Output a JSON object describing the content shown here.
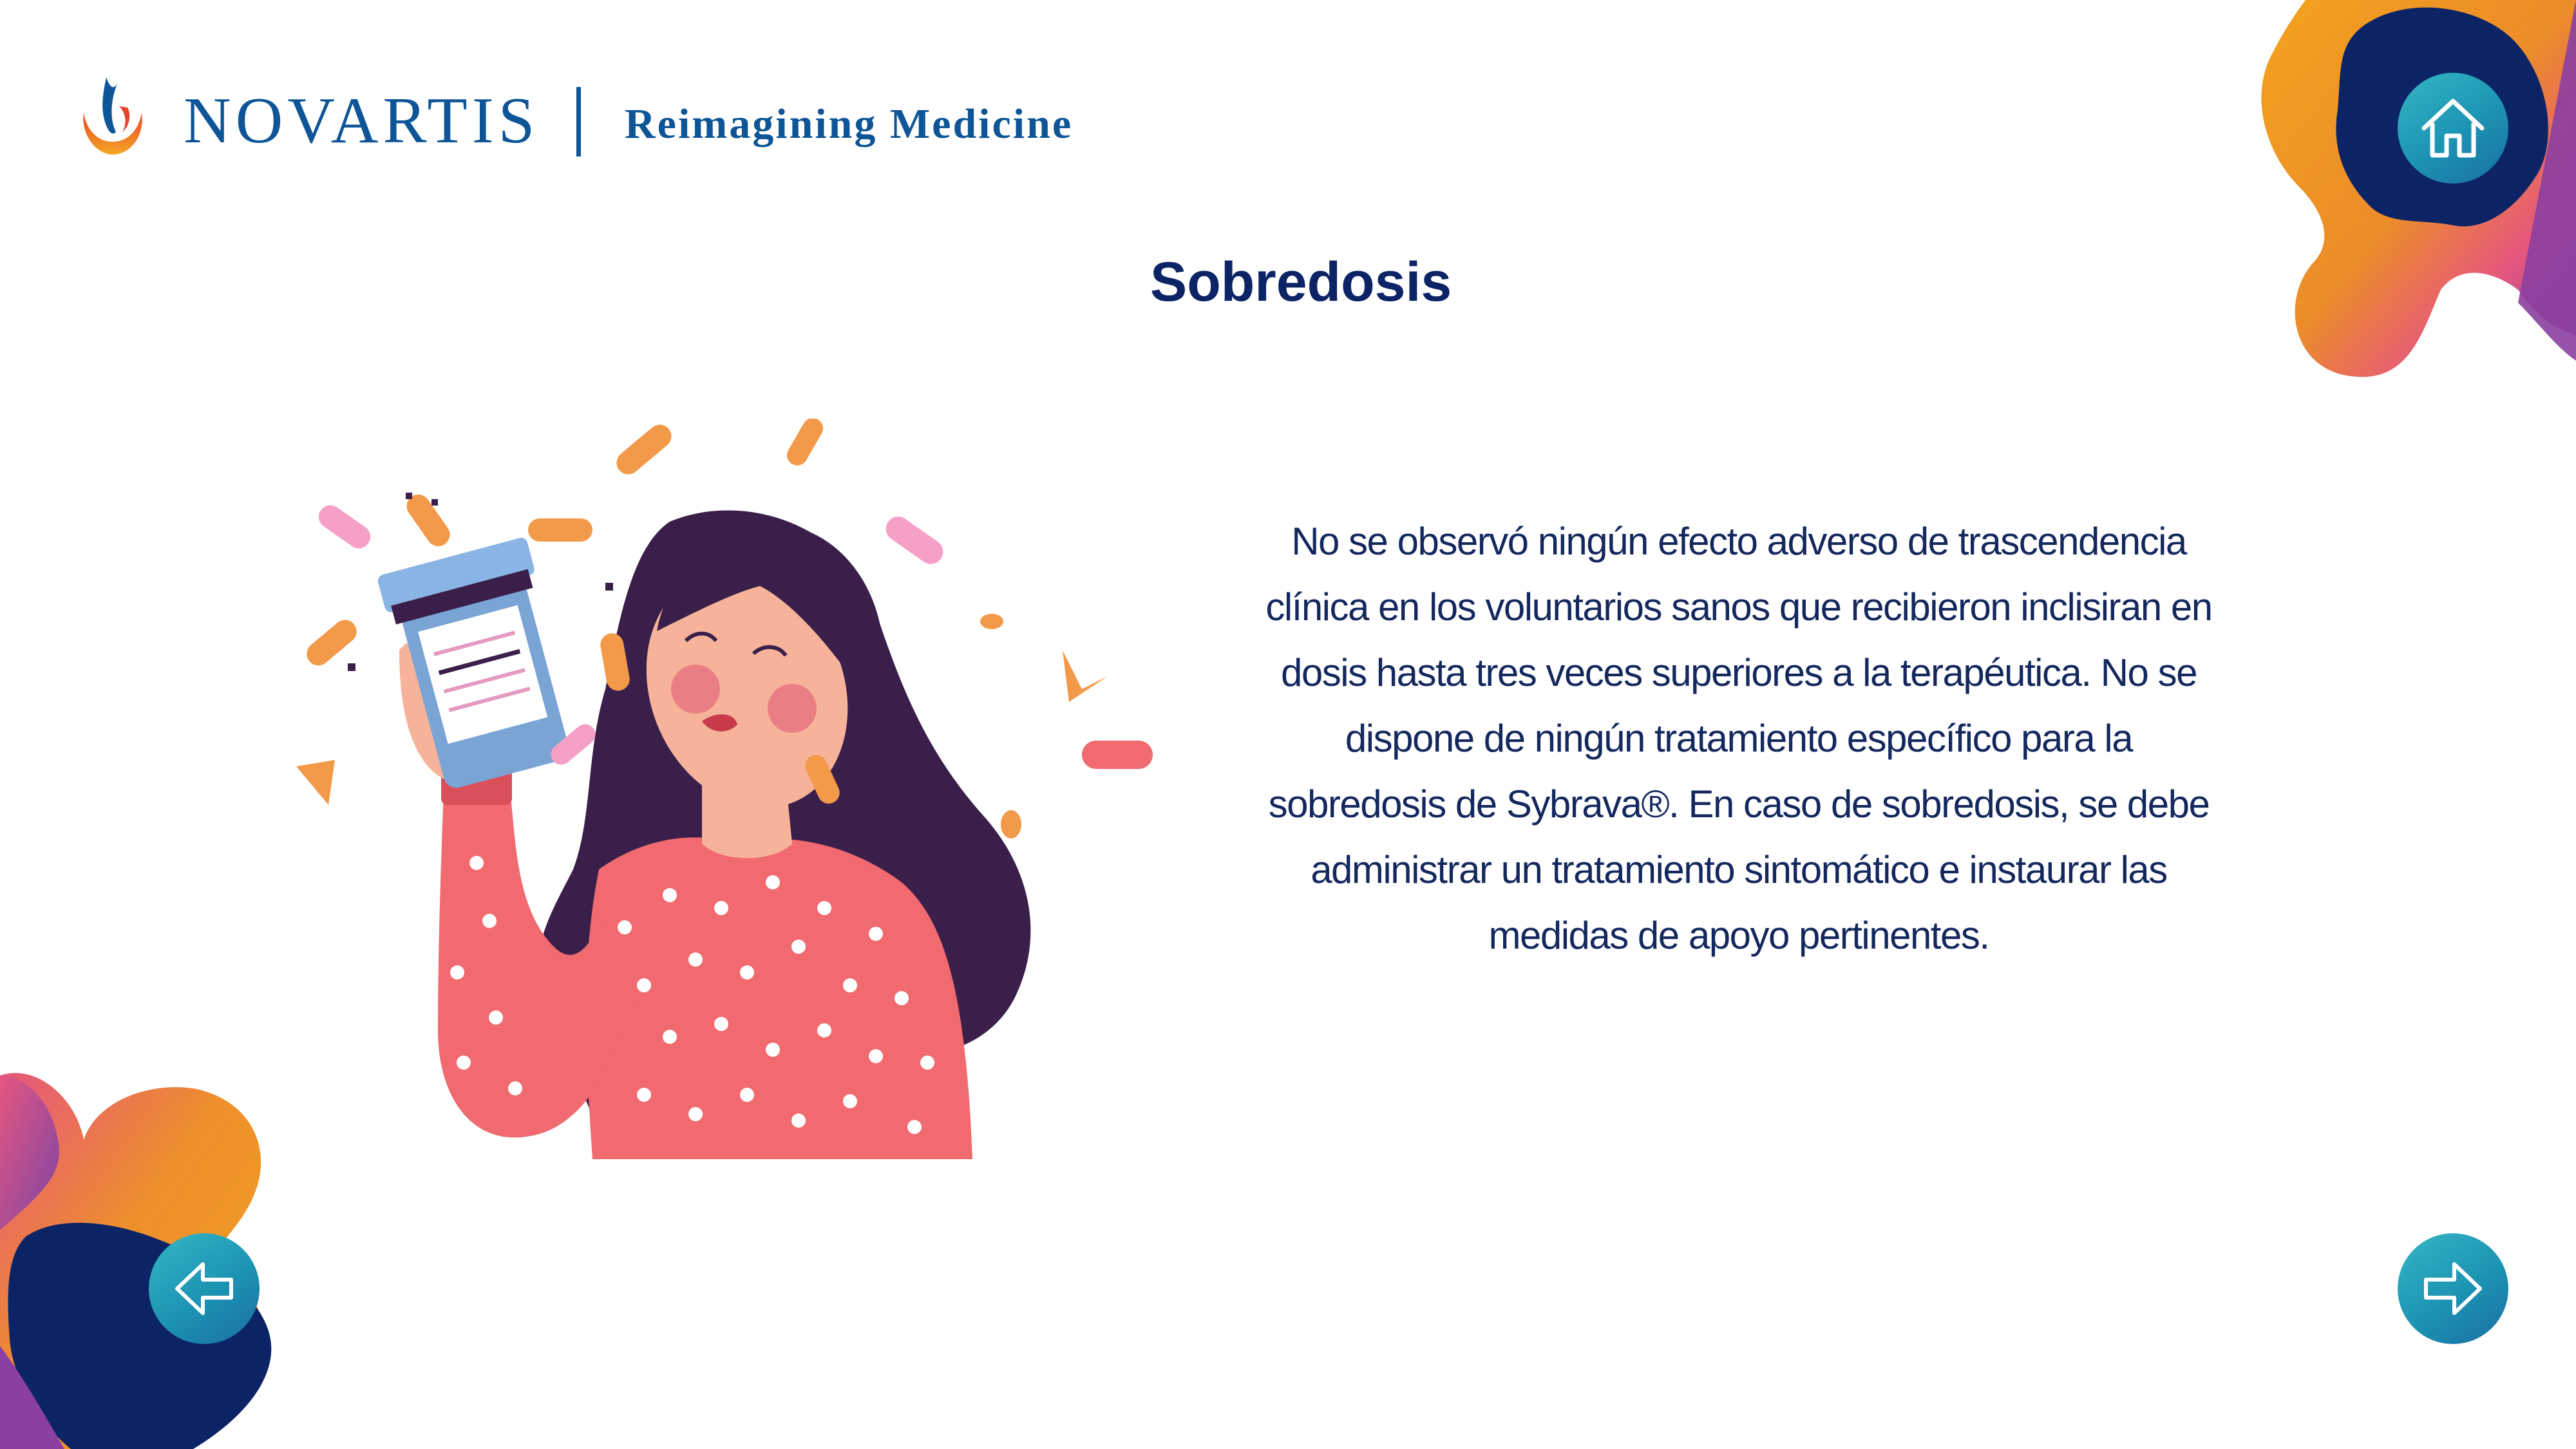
{
  "header": {
    "brand": "NOVARTIS",
    "tagline": "Reimagining Medicine"
  },
  "title": "Sobredosis",
  "body_text": "No se observó ningún efecto adverso de trascendencia clínica en los voluntarios sanos que recibieron inclisiran en dosis hasta tres veces superiores a la terapéutica. No se dispone de ningún tratamiento específico para la sobredosis de Sybrava®. En caso de sobredosis, se debe administrar un tratamiento sintomático e instaurar las medidas de apoyo pertinentes.",
  "nav": {
    "home_icon": "home-icon",
    "back_icon": "arrow-left-icon",
    "next_icon": "arrow-right-icon"
  },
  "colors": {
    "title": "#0c2466",
    "body": "#14285e",
    "brand_blue": "#0d5596",
    "navy": "#0c2466",
    "orange": "#f0a020",
    "pink": "#e8508a",
    "purple": "#8b3fa0",
    "teal": "#2aa6bf"
  }
}
